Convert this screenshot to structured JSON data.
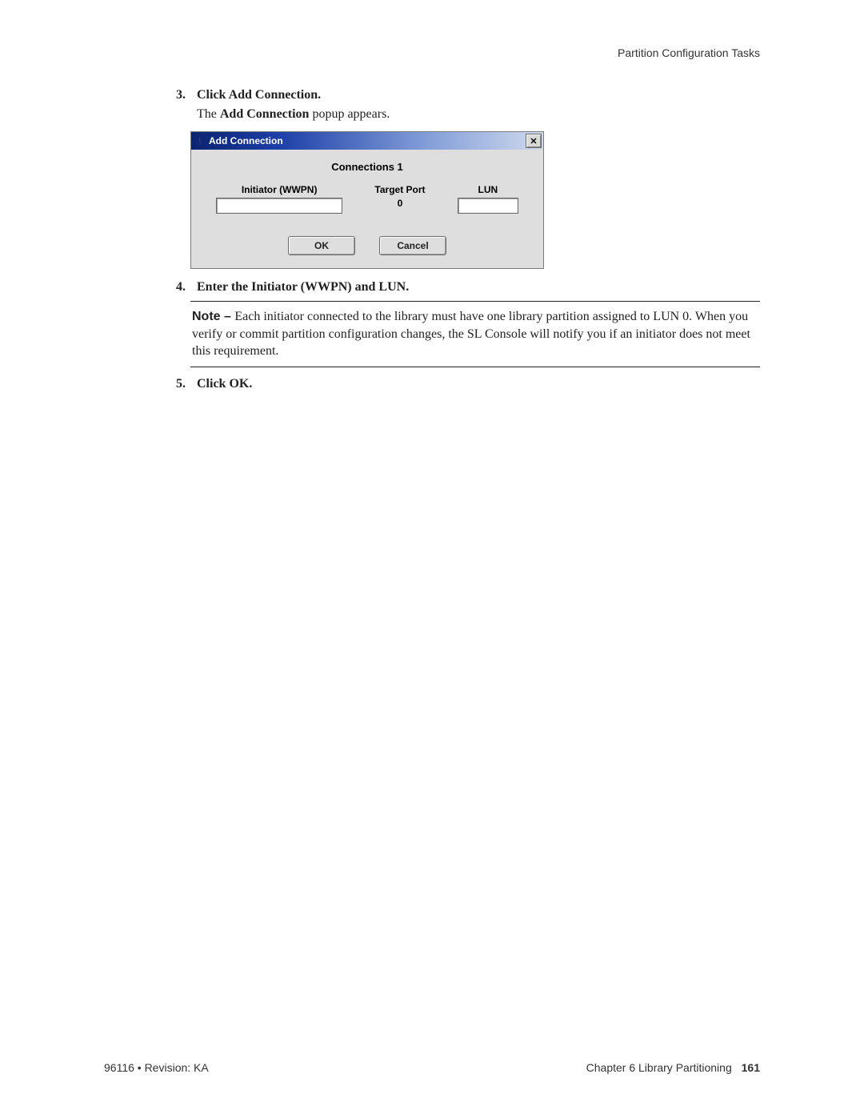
{
  "running_head": "Partition Configuration Tasks",
  "steps": {
    "s3": {
      "num": "3.",
      "text": "Click Add Connection."
    },
    "s3_note_prefix": "The ",
    "s3_note_bold": "Add Connection",
    "s3_note_suffix": " popup appears.",
    "s4": {
      "num": "4.",
      "text": "Enter the Initiator (WWPN) and LUN."
    },
    "s5": {
      "num": "5.",
      "text": "Click OK."
    }
  },
  "dialog": {
    "title": "Add Connection",
    "close_glyph": "✕",
    "connections_heading": "Connections 1",
    "fields": {
      "initiator_label": "Initiator (WWPN)",
      "target_port_label": "Target Port",
      "target_port_value": "0",
      "lun_label": "LUN"
    },
    "buttons": {
      "ok": "OK",
      "cancel": "Cancel"
    }
  },
  "note": {
    "label": "Note – ",
    "body": "Each initiator connected to the library must have one library partition assigned to LUN 0. When you verify or commit partition configuration changes, the SL Console will notify you if an initiator does not meet this requirement."
  },
  "footer": {
    "left": "96116  •  Revision: KA",
    "right_prefix": "Chapter 6 Library Partitioning",
    "page_num": "161"
  }
}
